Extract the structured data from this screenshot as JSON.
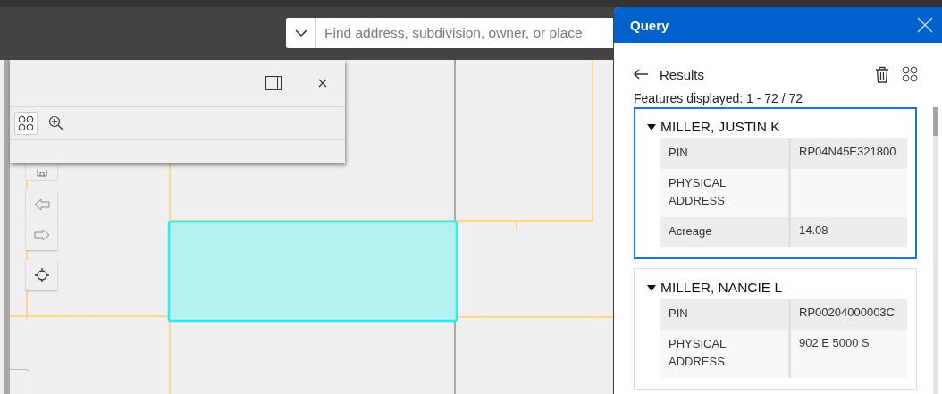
{
  "search": {
    "placeholder": "Find address, subdivision, owner, or place"
  },
  "query_panel": {
    "title": "Query",
    "section": "Results",
    "summary": "Features displayed: 1 - 72 / 72",
    "results": [
      {
        "name": "MILLER, JUSTIN K",
        "expanded": true,
        "selected": true,
        "fields": [
          {
            "label": "PIN",
            "value": "RP04N45E321800"
          },
          {
            "label": "PHYSICAL ADDRESS"
          },
          {
            "label": "Acreage",
            "value": "14.08"
          }
        ]
      },
      {
        "name": "MILLER, NANCIE L",
        "expanded": true,
        "selected": false,
        "fields": [
          {
            "label": "PIN",
            "value": "RP00204000003C"
          },
          {
            "label": "PHYSICAL ADDRESS",
            "value": "902 E 5000 S"
          }
        ]
      }
    ]
  }
}
